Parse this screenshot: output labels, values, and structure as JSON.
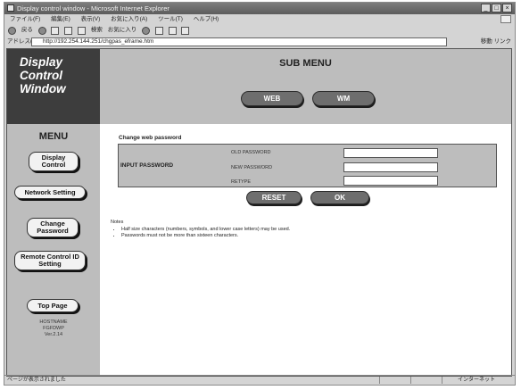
{
  "window": {
    "title": "Display control window - Microsoft Internet Explorer",
    "controls": [
      "_",
      "□",
      "×"
    ]
  },
  "menubar": {
    "items": [
      "ファイル(F)",
      "編集(E)",
      "表示(V)",
      "お気に入り(A)",
      "ツール(T)",
      "ヘルプ(H)"
    ]
  },
  "toolbar": {
    "back": "戻る",
    "search": "検索",
    "favorites": "お気に入り"
  },
  "addressbar": {
    "label": "アドレス(D)",
    "url": "http://192.254.144.251/chgpas_eframe.htm",
    "go": "移動",
    "links": "リンク"
  },
  "page": {
    "logo_lines": [
      "Display",
      "Control",
      "Window"
    ],
    "submenu_title": "SUB MENU",
    "submenu_buttons": {
      "web": "WEB",
      "wm": "WM"
    },
    "menu_title": "MENU",
    "menu_buttons": {
      "display_control": "Display Control",
      "network_setting": "Network Setting",
      "change_password": "Change Password",
      "remote_control": "Remote Control ID Setting",
      "top_page": "Top Page"
    },
    "host": {
      "label": "HOSTNAME",
      "name": "FGFDWP",
      "version": "Ver.2.14"
    },
    "section_title": "Change web password",
    "input_label": "INPUT PASSWORD",
    "rows": {
      "old": "OLD PASSWORD",
      "new": "NEW PASSWORD",
      "retype": "RETYPE"
    },
    "buttons": {
      "reset": "RESET",
      "ok": "OK"
    },
    "notes_title": "Notes",
    "notes": [
      "Half size characters (numbers, symbols, and lower case letters) may be used.",
      "Passwords must not be more than sixteen characters."
    ]
  },
  "statusbar": {
    "left": "ページが表示されました",
    "right": "インターネット"
  }
}
